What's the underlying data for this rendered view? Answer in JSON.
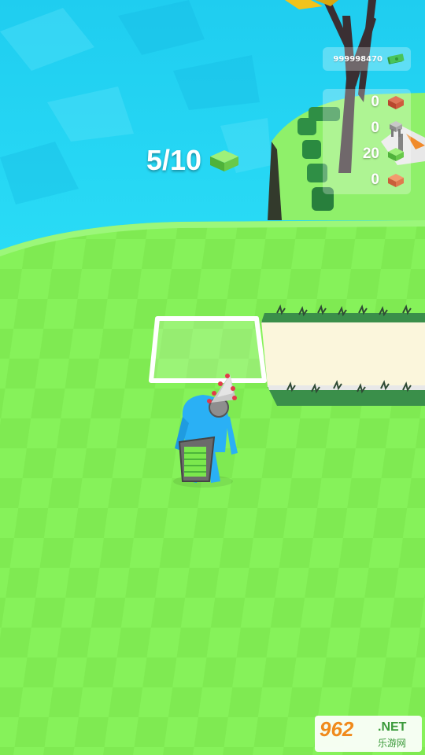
{
  "hud": {
    "money": "999998470",
    "money_icon": "cash-stack-icon",
    "resources": [
      {
        "count": "0",
        "icon": "brick-block-icon",
        "color": "#d05a3e"
      },
      {
        "count": "0",
        "icon": "stone-pillar-icon",
        "color": "#9a9a9a"
      },
      {
        "count": "20",
        "icon": "grass-block-icon",
        "color": "#7ed957"
      },
      {
        "count": "0",
        "icon": "clay-block-icon",
        "color": "#e07a4e"
      }
    ]
  },
  "carry": {
    "label": "5/10",
    "current": 5,
    "capacity": 10,
    "icon": "grass-block-icon"
  },
  "colors": {
    "water": "#20d2f0",
    "grass": "#86f25a",
    "grass_alt": "#7be84d",
    "path": "#fbf6dc",
    "player": "#2ab0f5"
  },
  "watermark": {
    "logo": "962",
    "net": ".NET",
    "sub": "乐游网"
  }
}
